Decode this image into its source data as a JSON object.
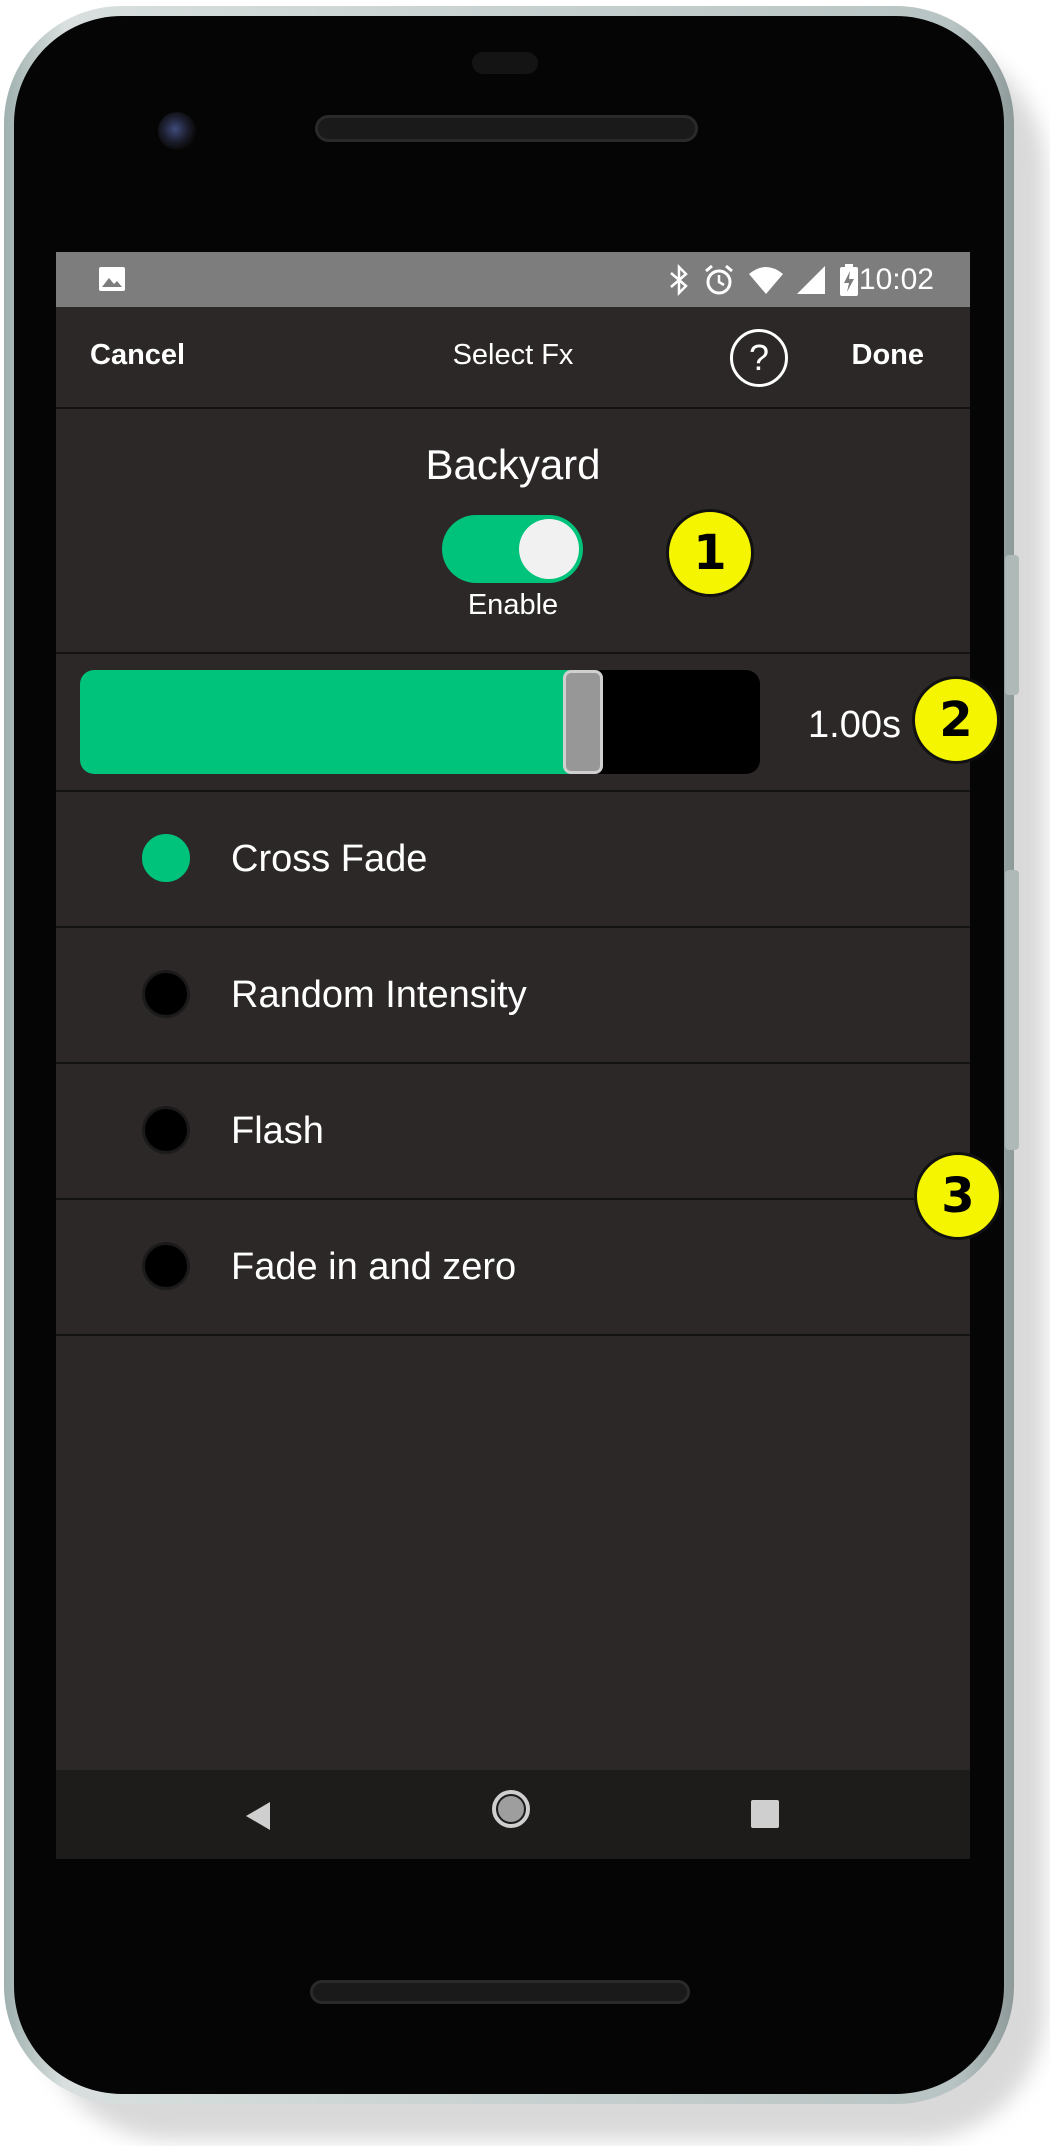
{
  "statusbar": {
    "time": "10:02",
    "icons": [
      "image-icon",
      "bluetooth-icon",
      "alarm-icon",
      "wifi-icon",
      "signal-icon",
      "battery-charging-icon"
    ]
  },
  "toolbar": {
    "cancel_label": "Cancel",
    "title": "Select Fx",
    "help_label": "?",
    "done_label": "Done"
  },
  "scene": {
    "name": "Backyard",
    "enable_label": "Enable",
    "enabled": true
  },
  "duration": {
    "value_label": "1.00s",
    "slider_fraction": 0.74
  },
  "fx_options": [
    {
      "label": "Cross Fade",
      "selected": true
    },
    {
      "label": "Random Intensity",
      "selected": false
    },
    {
      "label": "Flash",
      "selected": false
    },
    {
      "label": "Fade in and zero",
      "selected": false
    }
  ],
  "callouts": [
    "1",
    "2",
    "3"
  ],
  "colors": {
    "accent": "#00c37b",
    "background": "#2d2828",
    "statusbar": "#7d7d7d",
    "callout": "#f5f500"
  }
}
